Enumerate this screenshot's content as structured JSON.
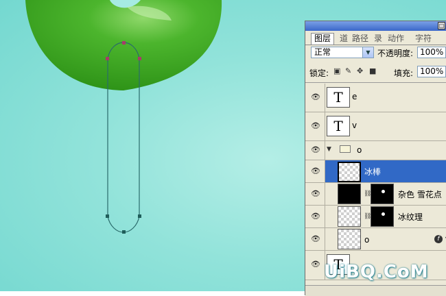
{
  "colors": {
    "canvas_bg": "#9fe7df",
    "donut": "#3aa823",
    "path_stroke": "#2a6b6b",
    "anchor_top": "#a83a6a",
    "anchor_bottom": "#1f5e5a",
    "selected_layer": "#3169c6"
  },
  "layers_panel": {
    "close_icon": "□",
    "tabs": [
      {
        "label": "图层",
        "active": true
      },
      {
        "label": "道",
        "active": false
      },
      {
        "label": "路径",
        "active": false
      },
      {
        "label": "录",
        "active": false
      },
      {
        "label": "动作",
        "active": false
      },
      {
        "label": "字符",
        "active": false
      }
    ],
    "blend_mode": "正常",
    "opacity_label": "不透明度:",
    "opacity_value": "100%",
    "lock_label": "锁定:",
    "fill_label": "填充:",
    "fill_value": "100%",
    "layers": [
      {
        "name": "e",
        "thumb": "T",
        "type": "text"
      },
      {
        "name": "v",
        "thumb": "T",
        "type": "text"
      },
      {
        "name": "o",
        "type": "group"
      },
      {
        "name": "冰棒",
        "type": "pixel",
        "selected": true
      },
      {
        "name": "杂色 雪花点",
        "type": "masked"
      },
      {
        "name": "冰纹理",
        "type": "masked"
      },
      {
        "name": "o",
        "type": "pixel",
        "fx": "f"
      },
      {
        "name": "",
        "thumb": "T",
        "type": "text"
      }
    ]
  },
  "watermark": "UiBQ.CoM"
}
